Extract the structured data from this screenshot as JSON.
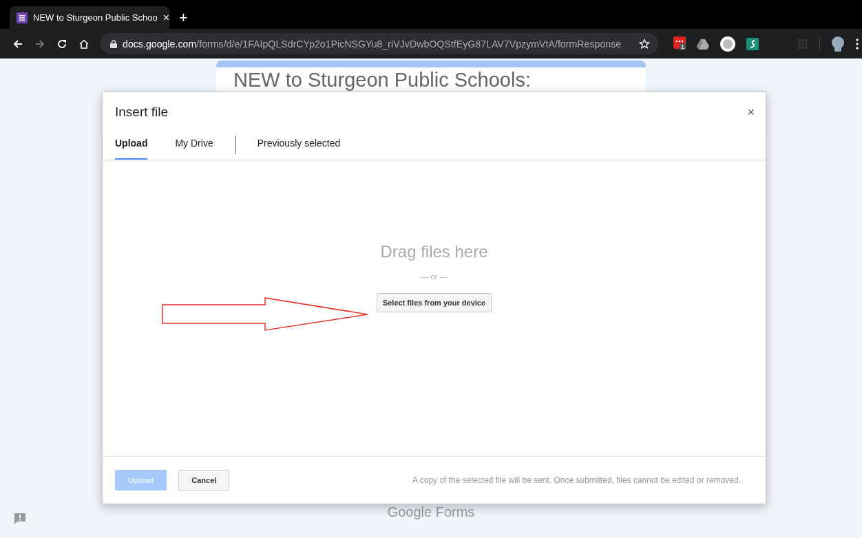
{
  "browser": {
    "tab": {
      "title": "NEW to Sturgeon Public Schoo",
      "close": "×"
    },
    "new_tab": "+",
    "url": {
      "host": "docs.google.com",
      "path": "/forms/d/e/1FAIpQLSdrCYp2o1PicNSGYu8_riVJvDwbOQStfEyG87LAV7VpzymVtA/formResponse"
    },
    "extension_badge": "1"
  },
  "form": {
    "title": "NEW to Sturgeon Public Schools:",
    "footer": "Google Forms"
  },
  "dialog": {
    "title": "Insert file",
    "close": "×",
    "tabs": [
      {
        "label": "Upload",
        "selected": true
      },
      {
        "label": "My Drive",
        "selected": false
      },
      {
        "label": "Previously selected",
        "selected": false
      }
    ],
    "drop_hint": "Drag files here",
    "or": "— or —",
    "select_button": "Select files from your device",
    "buttons": [
      {
        "label": "Upload",
        "kind": "primary",
        "disabled": true
      },
      {
        "label": "Cancel",
        "kind": "secondary",
        "disabled": false
      }
    ],
    "note": "A copy of the selected file will be sent. Once submitted, files cannot be edited or removed."
  }
}
